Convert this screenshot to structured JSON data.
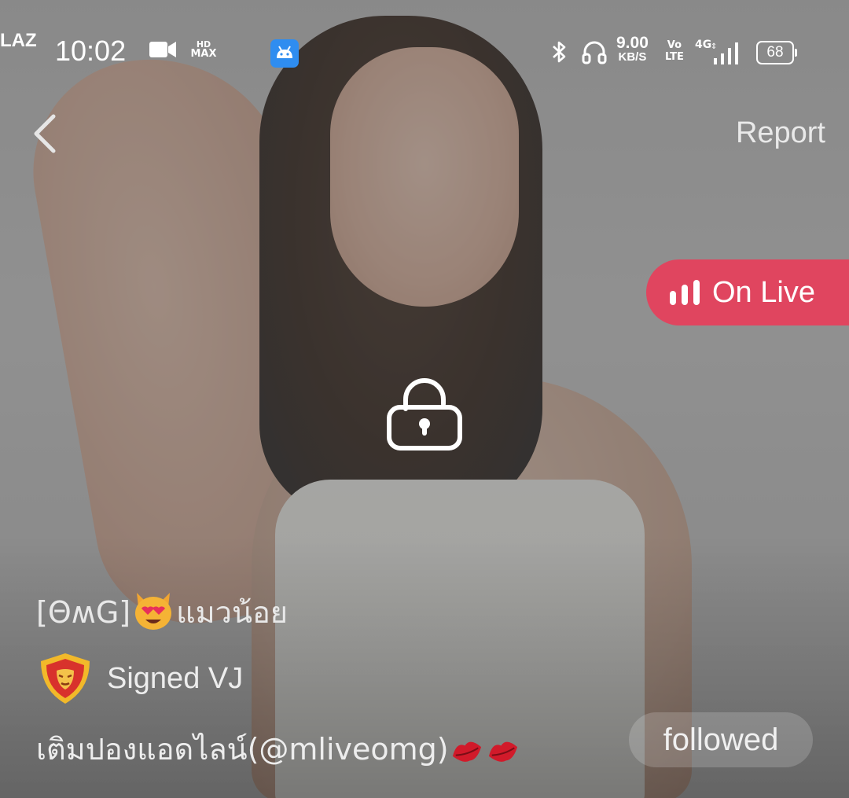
{
  "status_bar": {
    "time": "10:02",
    "speed_value": "9.00",
    "speed_unit": "KB/S",
    "volte_top": "Vo",
    "volte_bottom": "LTE",
    "network": "4G",
    "battery": "68",
    "laz": "LAZ",
    "hd_max_top": "HD",
    "hd_max_bottom": "MAX",
    "icons": [
      "video-icon",
      "hd-max-icon",
      "laz-icon",
      "android-app-icon",
      "bluetooth-icon",
      "headset-icon",
      "signal-icon",
      "battery-icon"
    ]
  },
  "header": {
    "back_icon": "chevron-left-icon",
    "report_label": "Report"
  },
  "live": {
    "label": "On Live",
    "icon": "live-bars-icon",
    "color": "#e0455f"
  },
  "lock": {
    "icon": "unlock-icon"
  },
  "profile": {
    "name_prefix": "[ΘʍG]",
    "name_emoji": "heart-eyes-cat-emoji",
    "name_suffix": "แมวน้อย",
    "badge_icon": "shield-mask-icon",
    "badge_label": "Signed VJ",
    "bio_text": "เติมปองแอดไลน์(@mliveomg)",
    "bio_emojis": [
      "kiss-lips-emoji",
      "kiss-lips-emoji"
    ],
    "follow_label": "followed"
  }
}
